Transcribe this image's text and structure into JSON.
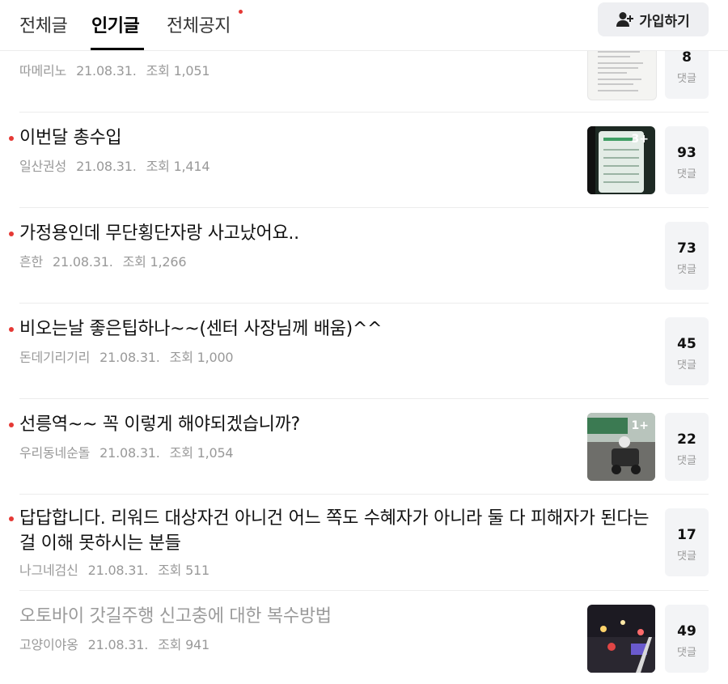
{
  "tabs": {
    "all": "전체글",
    "popular": "인기글",
    "notice": "전체공지"
  },
  "join_button": {
    "label": "가입하기",
    "icon": "add-user-icon"
  },
  "comment_label": "댓글",
  "posts": [
    {
      "title": "",
      "author": "따메리노",
      "date": "21.08.31.",
      "views": "조회 1,051",
      "comments": "8",
      "thumb_badge": ""
    },
    {
      "title": "이번달 총수입",
      "author": "일산권성",
      "date": "21.08.31.",
      "views": "조회 1,414",
      "comments": "93",
      "thumb_badge": "3+"
    },
    {
      "title": "가정용인데 무단횡단자랑 사고났어요..",
      "author": "흔한",
      "date": "21.08.31.",
      "views": "조회 1,266",
      "comments": "73",
      "thumb_badge": ""
    },
    {
      "title": "비오는날 좋은팁하나~~(센터 사장님께 배움)^^",
      "author": "돈데기리기리",
      "date": "21.08.31.",
      "views": "조회 1,000",
      "comments": "45",
      "thumb_badge": ""
    },
    {
      "title": "선릉역~~ 꼭 이렇게 해야되겠습니까?",
      "author": "우리동네순돌",
      "date": "21.08.31.",
      "views": "조회 1,054",
      "comments": "22",
      "thumb_badge": "1+"
    },
    {
      "title": "답답합니다. 리워드 대상자건 아니건 어느 쪽도 수혜자가 아니라 둘 다 피해자가 된다는걸 이해 못하시는 분들",
      "author": "나그네검신",
      "date": "21.08.31.",
      "views": "조회 511",
      "comments": "17",
      "thumb_badge": ""
    },
    {
      "title": "오토바이 갓길주행 신고충에 대한 복수방법",
      "author": "고양이야옹",
      "date": "21.08.31.",
      "views": "조회 941",
      "comments": "49",
      "thumb_badge": ""
    }
  ],
  "colors": {
    "new_dot": "#e53935",
    "comment_box": "#f3f4f6",
    "meta_text": "#999999"
  }
}
